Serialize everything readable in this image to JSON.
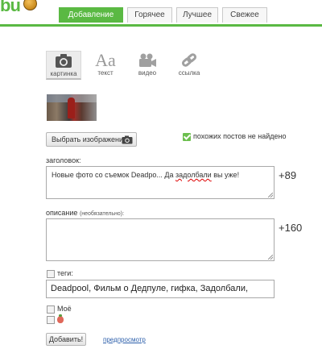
{
  "header": {
    "logo_text": "bu",
    "tabs": [
      {
        "label": "Добавление поста",
        "active": true
      },
      {
        "label": "Горячее",
        "active": false
      },
      {
        "label": "Лучшее",
        "active": false
      },
      {
        "label": "Свежее",
        "active": false
      }
    ],
    "accent_color": "#5ab943"
  },
  "media_types": [
    {
      "label": "картинка",
      "icon": "camera-icon",
      "active": true
    },
    {
      "label": "текст",
      "icon": "text-aa-icon",
      "active": false
    },
    {
      "label": "видео",
      "icon": "video-camera-icon",
      "active": false
    },
    {
      "label": "ссылка",
      "icon": "link-icon",
      "active": false
    }
  ],
  "image": {
    "choose_button": "Выбрать изображение",
    "similar_status": "похожих постов не найдено"
  },
  "form": {
    "title_label": "заголовок:",
    "title_value_before": "Новые фото со съемок Deadpo... Да ",
    "title_value_error_word": "задолбали",
    "title_value_after": " вы уже!",
    "title_counter": "+89",
    "description_label": "описание",
    "description_optional": "(необязательно):",
    "description_value": "",
    "description_counter": "+160",
    "tags_label": "теги:",
    "tags_value": "Deadpool, Фильм о Дедпуле, гифка, Задолбали,",
    "mine_label": "Моё",
    "submit_button": "Добавить!",
    "preview_link": "предпросмотр"
  }
}
